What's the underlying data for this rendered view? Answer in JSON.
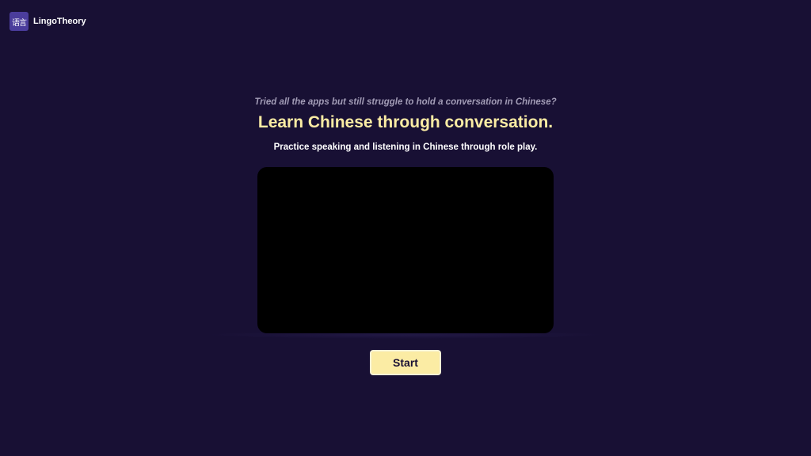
{
  "brand": {
    "logo_glyph": "语言",
    "name": "LingoTheory"
  },
  "hero": {
    "tagline": "Tried all the apps but still struggle to hold a conversation in Chinese?",
    "headline": "Learn Chinese through conversation.",
    "subheadline": "Practice speaking and listening in Chinese through role play."
  },
  "cta": {
    "start_label": "Start"
  },
  "colors": {
    "background": "#181034",
    "headline": "#fbeca4",
    "tagline": "#a29cb6",
    "button": "#fbeca4",
    "button_text": "#181034",
    "logo_bg": "#4b3d9c",
    "video_bg": "#000000"
  }
}
